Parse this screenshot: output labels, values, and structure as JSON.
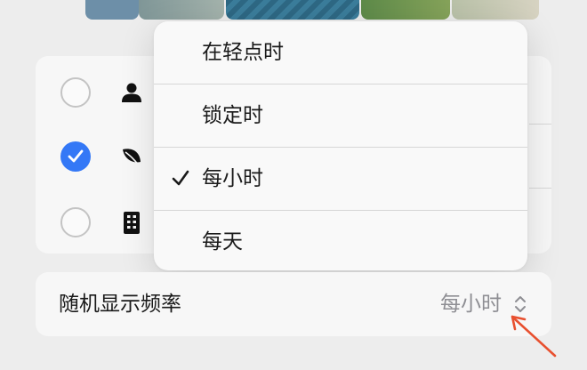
{
  "photo_strip": {
    "thumbs": [
      {
        "color": "#6d8fa8"
      },
      {
        "color": "#8fa3a2"
      },
      {
        "color": "#2f6a86"
      },
      {
        "color": "#5c8a4a"
      },
      {
        "color": "#c9c3a8"
      }
    ]
  },
  "categories": [
    {
      "icon": "person-icon",
      "selected": false
    },
    {
      "icon": "leaf-icon",
      "selected": true
    },
    {
      "icon": "building-icon",
      "selected": false
    }
  ],
  "menu": {
    "items": [
      {
        "label": "在轻点时",
        "checked": false
      },
      {
        "label": "锁定时",
        "checked": false
      },
      {
        "label": "每小时",
        "checked": true
      },
      {
        "label": "每天",
        "checked": false
      }
    ]
  },
  "frequency": {
    "label": "随机显示频率",
    "value": "每小时"
  },
  "colors": {
    "accent": "#3478f6",
    "annotation_arrow": "#e8502f"
  }
}
